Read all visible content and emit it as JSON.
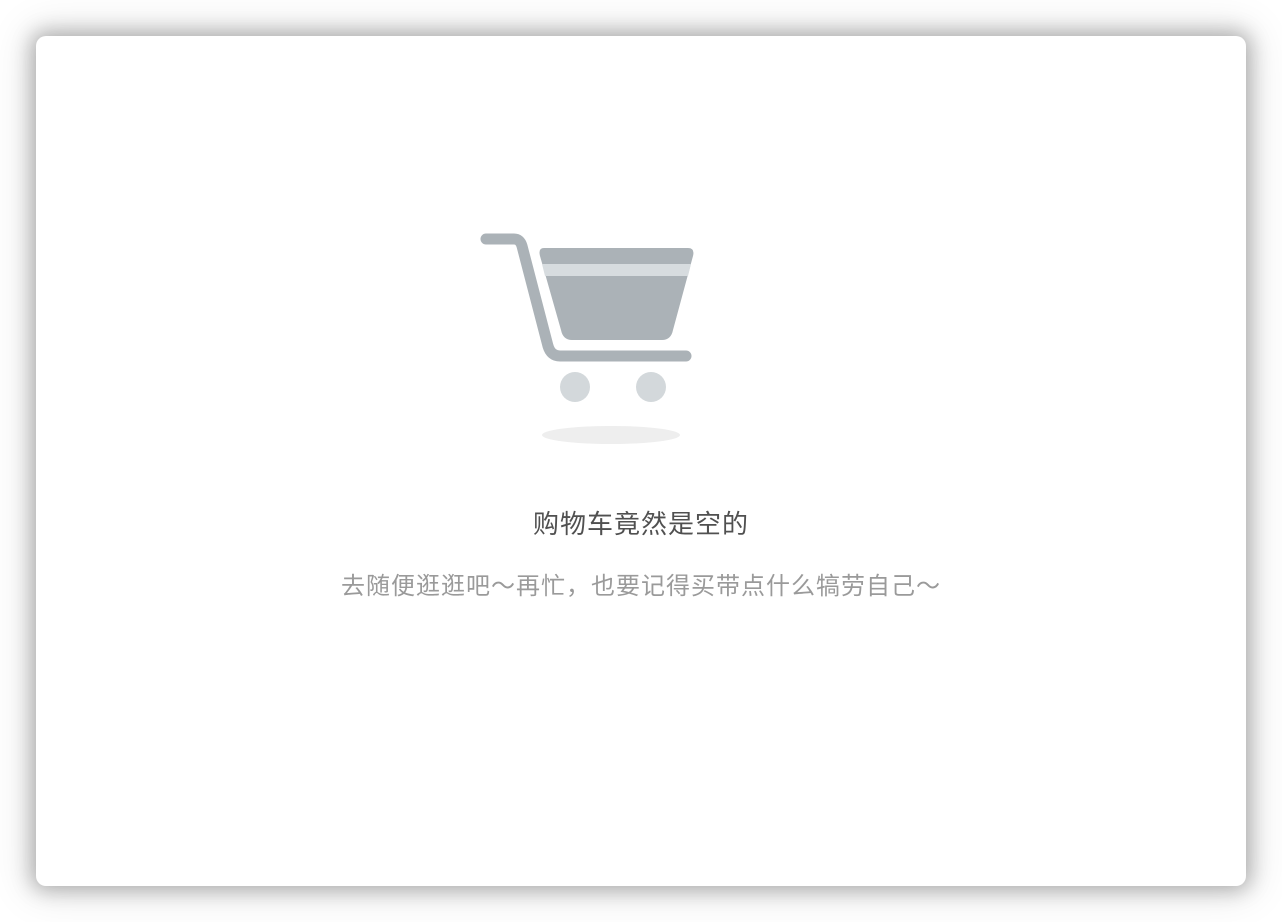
{
  "empty_cart": {
    "title": "购物车竟然是空的",
    "subtitle": "去随便逛逛吧～再忙，也要记得买带点什么犒劳自己～"
  },
  "illustration": {
    "icon": "shopping-cart-icon",
    "colors": {
      "cart_body": "#abb2b7",
      "cart_stripe": "#d7dcdf",
      "wheels": "#d3d8db",
      "shadow": "#eeeeee"
    }
  }
}
